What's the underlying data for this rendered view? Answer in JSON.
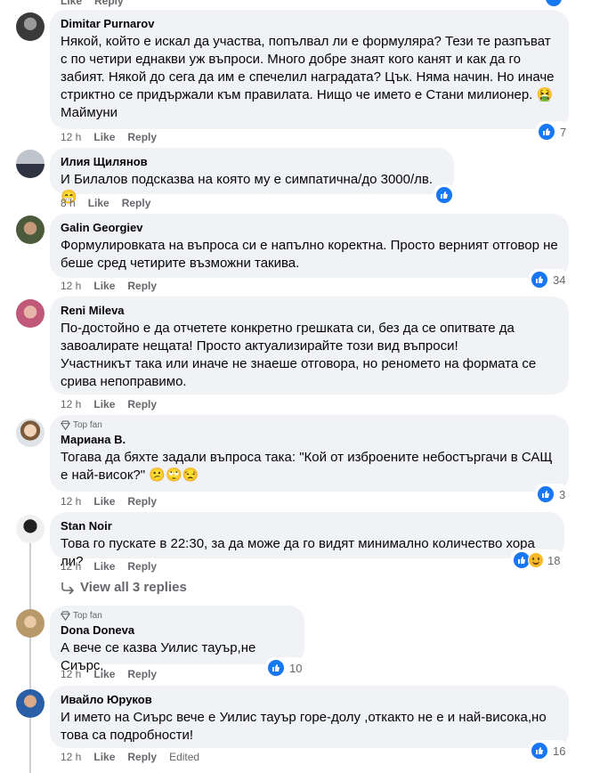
{
  "top_partial": {
    "like": "Like",
    "reply": "Reply"
  },
  "comments": [
    {
      "author": "Dimitar Purnarov",
      "text": "Някой, който е искал да участва, попълвал ли е формуляра? Тези те разпъват с по четири еднакви уж въпроси. Много добре знаят кого канят и как да го забият. Някой до сега да им е спечелил наградата? Цък. Няма начин. Но иначе стриктно се придържали към правилата. Нищо че името е Стани милионер. 🤮 Маймуни",
      "time": "12 h",
      "like": "Like",
      "reply": "Reply",
      "reactions": "7"
    },
    {
      "author": "Илия Щилянов",
      "text": "И Билалов подсказва на която му е симпатична/до 3000/лв.😁",
      "time": "8 h",
      "like": "Like",
      "reply": "Reply",
      "reactions": ""
    },
    {
      "author": "Galin Georgiev",
      "text": "Формулировката на въпроса си е напълно коректна. Просто верният отговор не беше сред четирите възможни такива.",
      "time": "12 h",
      "like": "Like",
      "reply": "Reply",
      "reactions": "34"
    },
    {
      "author": "Reni Mileva",
      "text": "По-достойно е да отчетете конкретно грешката си, без да се опитвате да завоалирате нещата! Просто актуализирайте този вид въпроси!\nУчастникът така или иначе не знаеше отговора, но реномето на формата се срива непоправимо.",
      "time": "12 h",
      "like": "Like",
      "reply": "Reply",
      "reactions": ""
    },
    {
      "badge": "Top fan",
      "author": "Мариана В.",
      "text": "Тогава да бяхте задали въпроса така: \"Кой от изброените небостъргачи в САЩ е най-висок?\" 😕🙄😒",
      "time": "12 h",
      "like": "Like",
      "reply": "Reply",
      "reactions": "3"
    },
    {
      "author": "Stan Noir",
      "text": "Това го пускате в 22:30, за да може да го видят минимално количество хора ли?",
      "time": "12 h",
      "like": "Like",
      "reply": "Reply",
      "reactions": "18"
    },
    {
      "badge": "Top fan",
      "author": "Dona Doneva",
      "text": "А вече се казва Уилис тауър,не Сиърс.",
      "time": "12 h",
      "like": "Like",
      "reply": "Reply",
      "reactions": "10"
    },
    {
      "author": "Ивайло Юруков",
      "text": "И името на Сиърс вече е Уилис тауър горе-долу ,откакто не е и най-висока,но това са подробности!",
      "time": "12 h",
      "like": "Like",
      "reply": "Reply",
      "edited": "Edited",
      "reactions": "16"
    }
  ],
  "view_replies": "View all 3 replies",
  "colors": {
    "bubble": "#f0f2f5",
    "meta": "#65676b",
    "like_blue": "#1877f2"
  }
}
